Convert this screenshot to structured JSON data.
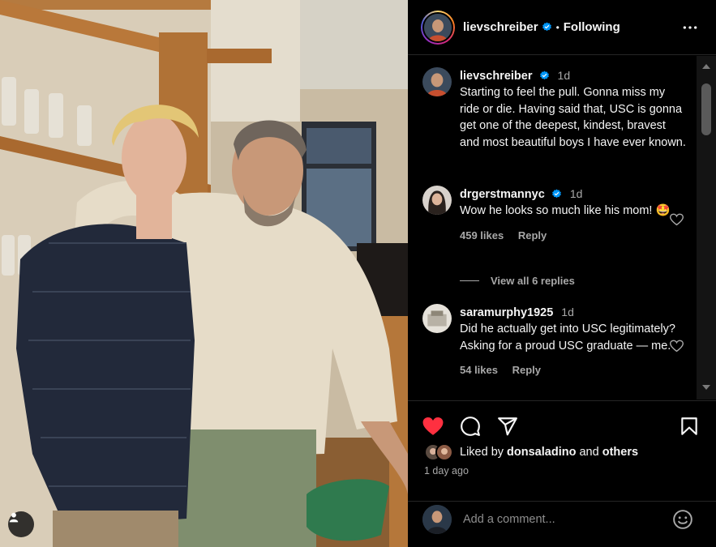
{
  "post": {
    "author": "lievschreiber",
    "follow_status": "Following",
    "separator": "•",
    "caption_time": "1d",
    "caption": "Starting to feel the pull. Gonna miss my ride or die. Having said that, USC is gonna get one of the deepest, kindest, bravest and most beautiful boys I have ever known."
  },
  "comments": [
    {
      "user": "drgerstmannyc",
      "time": "1d",
      "text": "Wow he looks so much like his mom! 🤩",
      "likes": "459 likes",
      "reply": "Reply"
    },
    {
      "user": "saramurphy1925",
      "time": "1d",
      "text": "Did he actually get into USC legitimately? Asking for a proud USC graduate — me.",
      "likes": "54 likes",
      "reply": "Reply"
    }
  ],
  "view_replies": "View all 6 replies",
  "liked_by": {
    "prefix": "Liked by",
    "user": "donsaladino",
    "conjunction": "and",
    "others": "others"
  },
  "timestamp": "1 day ago",
  "add_comment": {
    "placeholder": "Add a comment..."
  },
  "icons": {
    "header_more": "more-horizontal-icon",
    "verified": "verified-badge-icon",
    "like": "heart-filled-icon",
    "comment": "comment-icon",
    "share": "send-icon",
    "save": "bookmark-icon",
    "emoji": "emoji-icon",
    "tagged_user": "user-tag-icon"
  },
  "colors": {
    "background": "#000000",
    "text": "#f5f5f5",
    "muted": "#a8a8a8",
    "like_red": "#ff3040",
    "verified_blue": "#0095f6"
  }
}
